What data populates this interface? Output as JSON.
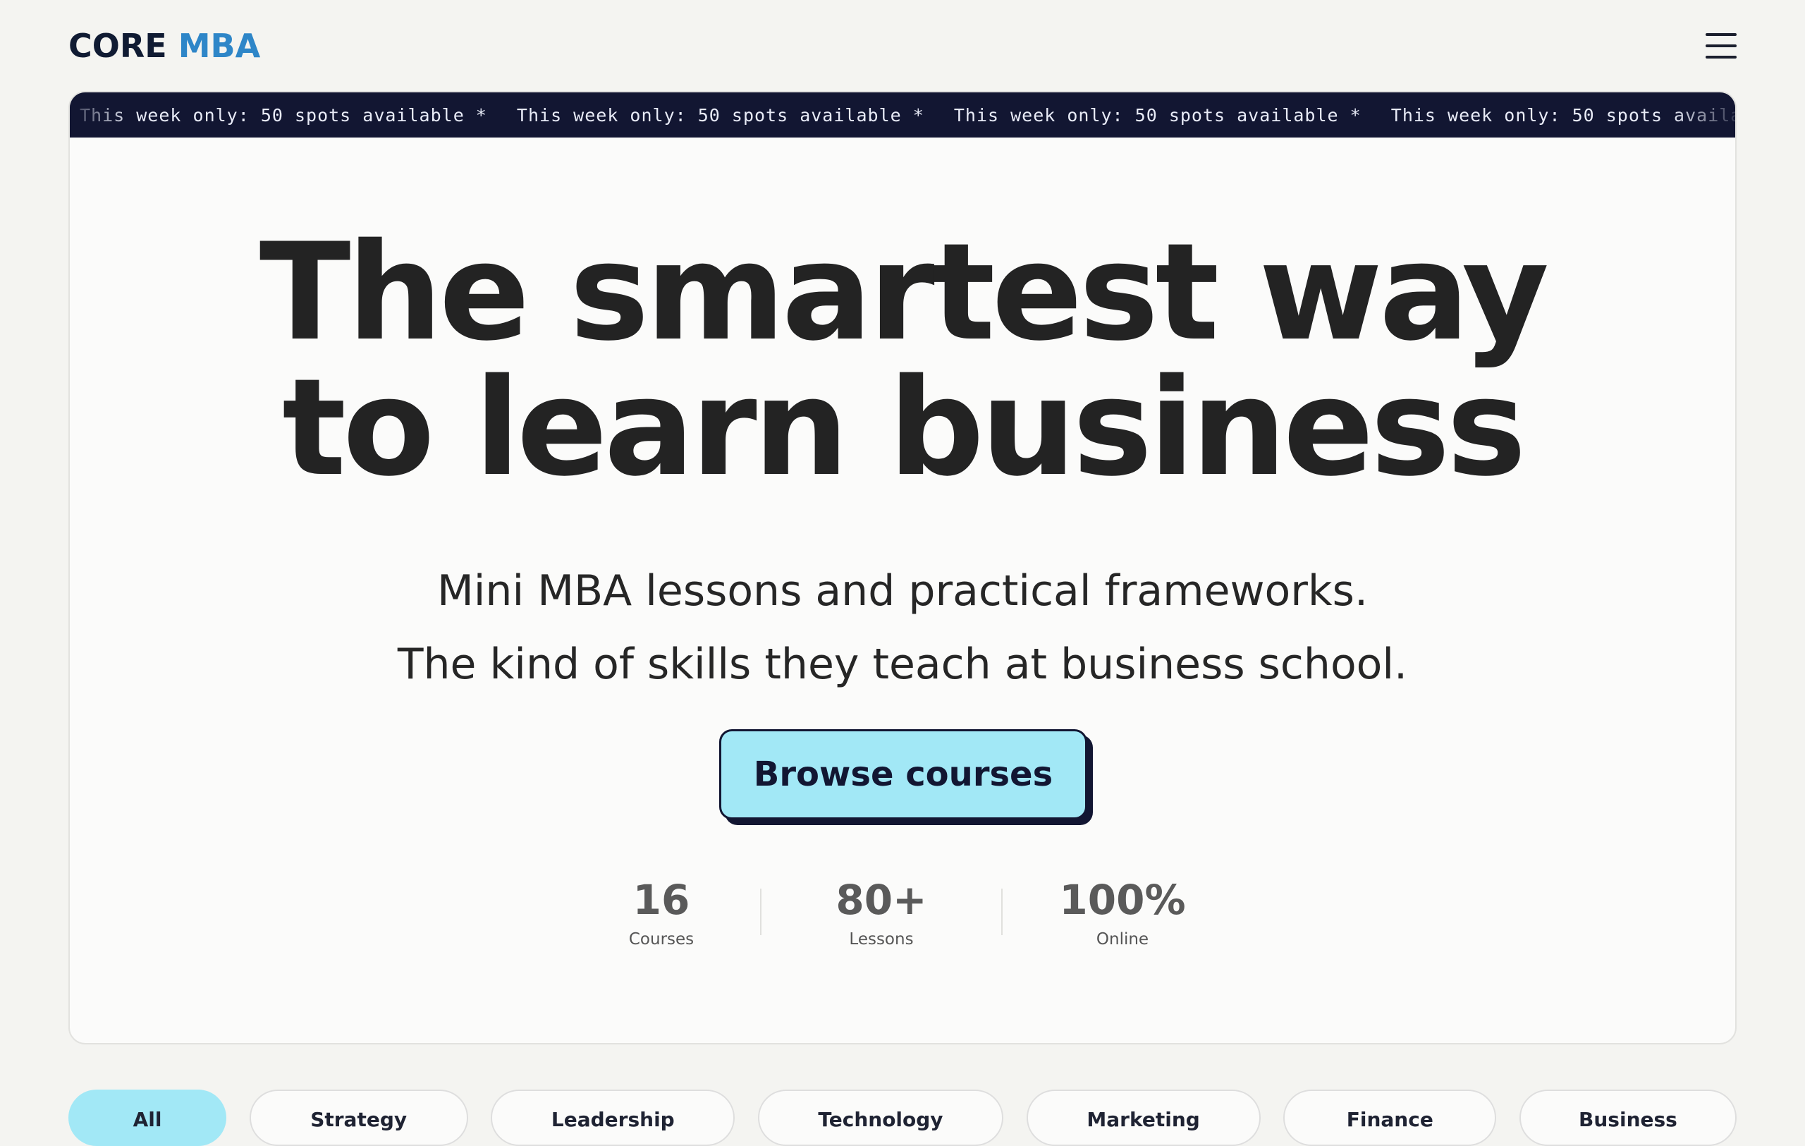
{
  "brand": {
    "name_main": "CORE",
    "name_accent": "MBA",
    "accent_color": "#2e86c8",
    "dark_color": "#101b33"
  },
  "header": {
    "menu_icon": "hamburger-menu-icon"
  },
  "ticker": {
    "text": "This week only: 50 spots available *",
    "background": "#121632"
  },
  "hero": {
    "headline_line1": "The smartest way",
    "headline_line2": "to learn business",
    "subtitle_line1": "Mini MBA lessons and practical frameworks.",
    "subtitle_line2": "The kind of skills they teach at business school.",
    "cta_label": "Browse courses",
    "cta_color": "#a2e8f6"
  },
  "stats": [
    {
      "value": "16",
      "label": "Courses"
    },
    {
      "value": "80+",
      "label": "Lessons"
    },
    {
      "value": "100%",
      "label": "Online"
    }
  ],
  "filters": [
    {
      "label": "All",
      "active": true
    },
    {
      "label": "Strategy",
      "active": false
    },
    {
      "label": "Leadership",
      "active": false
    },
    {
      "label": "Technology",
      "active": false
    },
    {
      "label": "Marketing",
      "active": false
    },
    {
      "label": "Finance",
      "active": false
    },
    {
      "label": "Business",
      "active": false
    }
  ]
}
